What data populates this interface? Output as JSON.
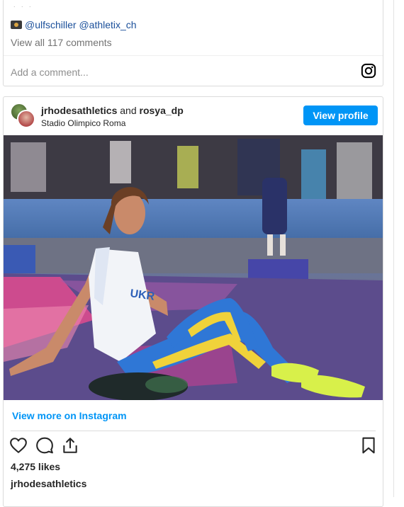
{
  "previous_post": {
    "caption_mentions": "@ulfschiller @athletix_ch",
    "view_comments": "View all 117 comments",
    "add_comment_placeholder": "Add a comment..."
  },
  "post": {
    "author": "jrhodesathletics",
    "connector": "and",
    "coauthor": "rosya_dp",
    "location": "Stadio Olimpico Roma",
    "view_profile_label": "View profile",
    "view_more_label": "View more on Instagram",
    "likes": "4,275 likes",
    "caption_username": "jrhodesathletics",
    "photo_text": "UKR"
  },
  "colors": {
    "accent": "#0095f6",
    "mention": "#1a4f9a"
  }
}
